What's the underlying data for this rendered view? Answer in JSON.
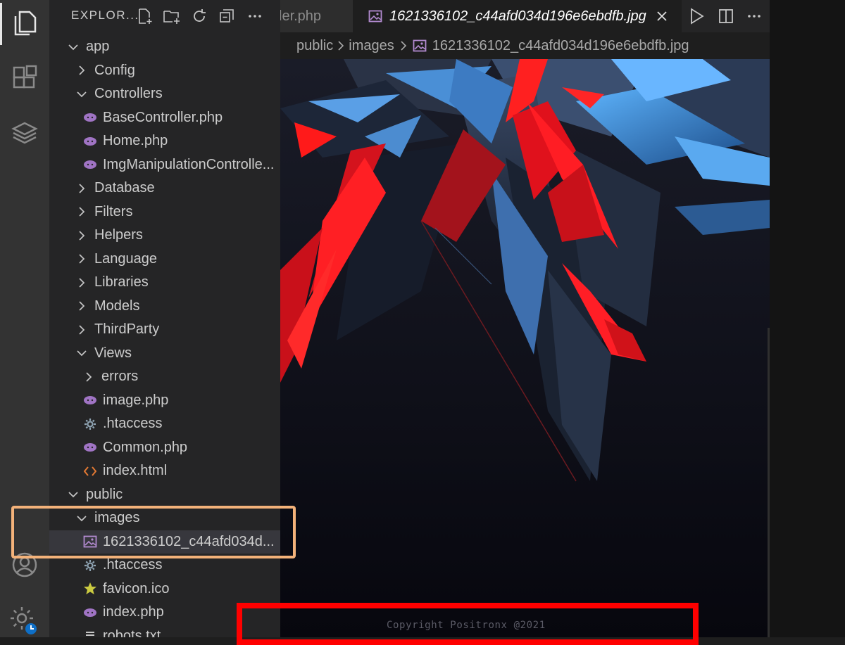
{
  "activity_bar": {
    "icons": [
      "files-icon",
      "extensions-icon",
      "database-icon",
      "account-icon",
      "settings-gear-icon"
    ]
  },
  "sidebar": {
    "title": "EXPLOR...",
    "tree": [
      {
        "label": "app",
        "kind": "folder-open",
        "depth": 0
      },
      {
        "label": "Config",
        "kind": "folder-closed",
        "depth": 1
      },
      {
        "label": "Controllers",
        "kind": "folder-open",
        "depth": 1
      },
      {
        "label": "BaseController.php",
        "kind": "php",
        "depth": 2
      },
      {
        "label": "Home.php",
        "kind": "php",
        "depth": 2
      },
      {
        "label": "ImgManipulationControlle...",
        "kind": "php",
        "depth": 2
      },
      {
        "label": "Database",
        "kind": "folder-closed",
        "depth": 1
      },
      {
        "label": "Filters",
        "kind": "folder-closed",
        "depth": 1
      },
      {
        "label": "Helpers",
        "kind": "folder-closed",
        "depth": 1
      },
      {
        "label": "Language",
        "kind": "folder-closed",
        "depth": 1
      },
      {
        "label": "Libraries",
        "kind": "folder-closed",
        "depth": 1
      },
      {
        "label": "Models",
        "kind": "folder-closed",
        "depth": 1
      },
      {
        "label": "ThirdParty",
        "kind": "folder-closed",
        "depth": 1
      },
      {
        "label": "Views",
        "kind": "folder-open",
        "depth": 1
      },
      {
        "label": "errors",
        "kind": "folder-closed",
        "depth": 2
      },
      {
        "label": "image.php",
        "kind": "php",
        "depth": 2
      },
      {
        "label": ".htaccess",
        "kind": "config",
        "depth": 1
      },
      {
        "label": "Common.php",
        "kind": "php",
        "depth": 1
      },
      {
        "label": "index.html",
        "kind": "html",
        "depth": 1
      },
      {
        "label": "public",
        "kind": "folder-open",
        "depth": 0
      },
      {
        "label": "images",
        "kind": "folder-open",
        "depth": 1
      },
      {
        "label": "1621336102_c44afd034d...",
        "kind": "image",
        "depth": 2,
        "selected": true
      },
      {
        "label": ".htaccess",
        "kind": "config",
        "depth": 1
      },
      {
        "label": "favicon.ico",
        "kind": "star",
        "depth": 1
      },
      {
        "label": "index.php",
        "kind": "php",
        "depth": 1
      },
      {
        "label": "robots.txt",
        "kind": "text",
        "depth": 1
      }
    ]
  },
  "tabs": {
    "inactive_label": "ler.php",
    "active_label": "1621336102_c44afd034d196e6ebdfb.jpg"
  },
  "breadcrumb": {
    "parts": [
      "public",
      "images",
      "1621336102_c44afd034d196e6ebdfb.jpg"
    ]
  },
  "preview": {
    "copyright": "Copyright Positronx @2021"
  },
  "colors": {
    "activity_bar": "#333333",
    "sidebar": "#252526",
    "editor": "#1e1e1e",
    "php_icon": "#a074c4",
    "image_icon": "#b38bd1",
    "htaccess_icon": "#8fa4b3",
    "html_icon": "#e37933",
    "star_icon": "#cbcb41",
    "highlight_orange": "#f3b27a",
    "highlight_red": "#ff0000"
  }
}
